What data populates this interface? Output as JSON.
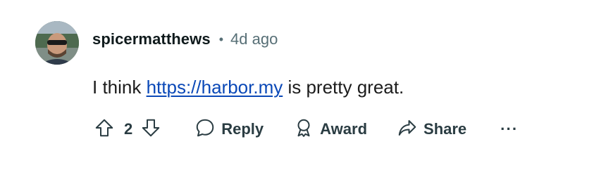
{
  "comment": {
    "author": "spicermatthews",
    "separator": "•",
    "timestamp": "4d ago",
    "text_before": "I think ",
    "link_text": "https://harbor.my",
    "text_after": " is pretty great."
  },
  "actions": {
    "score": "2",
    "reply_label": "Reply",
    "award_label": "Award",
    "share_label": "Share",
    "more_label": "···"
  },
  "icons": {
    "upvote": "upvote-arrow-icon",
    "downvote": "downvote-arrow-icon",
    "reply": "speech-bubble-icon",
    "award": "award-ribbon-icon",
    "share": "share-arrow-icon"
  },
  "colors": {
    "link": "#0a48b7",
    "muted": "#576f76",
    "action": "#2a3c42"
  }
}
